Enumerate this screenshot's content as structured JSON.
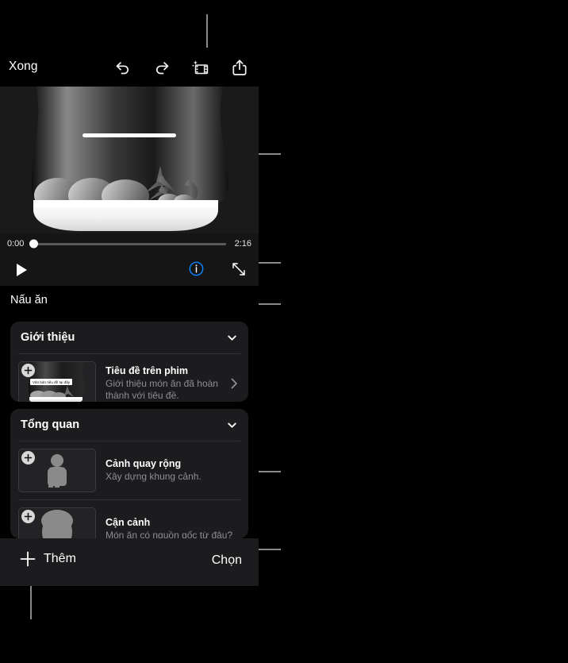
{
  "app": {
    "screen_title": "Nấu ăn"
  },
  "toolbar": {
    "done_label": "Xong",
    "icons": [
      {
        "name": "undo-icon",
        "label": "Hoàn tác"
      },
      {
        "name": "redo-icon",
        "label": "Làm lại"
      },
      {
        "name": "magic-movie-icon",
        "label": "Phim kỳ diệu"
      },
      {
        "name": "share-icon",
        "label": "Chia sẻ"
      }
    ]
  },
  "player": {
    "current_time": "0:00",
    "total_time": "2:16",
    "progress_percent": 0,
    "play_icon": "play-icon",
    "info_icon": "info-circle-icon",
    "info_icon_color": "#0a84ff",
    "expand_icon": "expand-fullscreen-icon"
  },
  "storyboard": {
    "sections": [
      {
        "header": "Giới thiệu",
        "chevron": "chevron-down-icon",
        "rows": [
          {
            "title": "Tiêu đề trên phim",
            "subtitle": "Giới thiệu món ăn đã hoàn thành với tiêu đề.",
            "thumbnail_caption": "Văn bản tiêu đề tại đây",
            "add_icon": "plus-badge-icon",
            "disclosure": "chevron-right-icon",
            "has_disclosure": true
          }
        ]
      },
      {
        "header": "Tổng quan",
        "chevron": "chevron-down-icon",
        "rows": [
          {
            "title": "Cảnh quay rộng",
            "subtitle": "Xây dựng khung cảnh.",
            "thumbnail_caption": "",
            "add_icon": "plus-badge-icon",
            "has_disclosure": false
          },
          {
            "title": "Cận cảnh",
            "subtitle": "Món ăn có nguồn gốc từ đâu?",
            "thumbnail_caption": "",
            "add_icon": "plus-badge-icon",
            "has_disclosure": false
          }
        ]
      }
    ]
  },
  "bottom_bar": {
    "add_label": "Thêm",
    "add_icon": "plus-icon",
    "select_label": "Chọn"
  },
  "colors": {
    "accent_blue": "#0a84ff",
    "background": "#000000",
    "card": "#1c1c1e",
    "secondary_text": "#8e8e93",
    "leader_line": "#8a8a8a"
  }
}
